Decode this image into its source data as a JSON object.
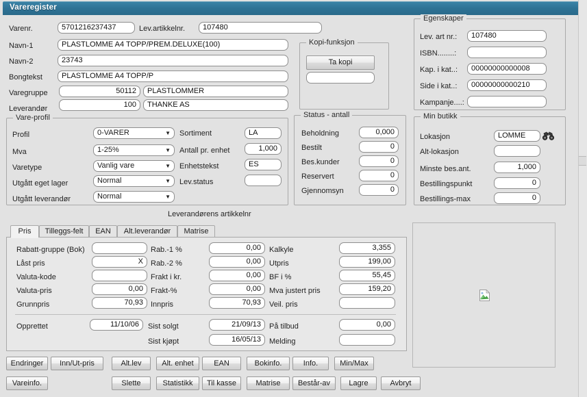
{
  "window": {
    "title": "Vareregister"
  },
  "top_fields": {
    "varenr_label": "Varenr.",
    "varenr_value": "5701216237437",
    "lev_artikkelnr_label": "Lev.artikkelnr.",
    "lev_artikkelnr_value": "107480",
    "navn1_label": "Navn-1",
    "navn1_value": "PLASTLOMME A4 TOPP/PREM.DELUXE(100)",
    "navn2_label": "Navn-2",
    "navn2_value": "23743",
    "bongtekst_label": "Bongtekst",
    "bongtekst_value": "PLASTLOMME A4 TOPP/P",
    "varegruppe_label": "Varegruppe",
    "varegruppe_code": "50112",
    "varegruppe_name": "PLASTLOMMER",
    "leverandor_label": "Leverandør",
    "leverandor_code": "100",
    "leverandor_name": "THANKE AS"
  },
  "vare_profil": {
    "caption": "Vare-profil",
    "rows": [
      {
        "label": "Profil",
        "value": "0-VARER"
      },
      {
        "label": "Mva",
        "value": "1-25%"
      },
      {
        "label": "Varetype",
        "value": "Vanlig vare"
      },
      {
        "label": "Utgått eget lager",
        "value": "Normal"
      },
      {
        "label": "Utgått leverandør",
        "value": "Normal"
      }
    ],
    "right_rows": [
      {
        "label": "Sortiment",
        "value": "LA",
        "align": "left"
      },
      {
        "label": "Antall pr. enhet",
        "value": "1,000",
        "align": "right"
      },
      {
        "label": "Enhetstekst",
        "value": "ES",
        "align": "left"
      },
      {
        "label": "Lev.status",
        "value": "",
        "align": "left"
      }
    ],
    "footer_note": "Leverandørens artikkelnr"
  },
  "kopi_funksjon": {
    "caption": "Kopi-funksjon",
    "button_label": "Ta kopi",
    "field_value": ""
  },
  "status_antall": {
    "caption": "Status - antall",
    "rows": [
      {
        "label": "Beholdning",
        "value": "0,000"
      },
      {
        "label": "Bestilt",
        "value": "0"
      },
      {
        "label": "Bes.kunder",
        "value": "0"
      },
      {
        "label": "Reservert",
        "value": "0"
      },
      {
        "label": "Gjennomsyn",
        "value": "0"
      }
    ]
  },
  "egenskaper": {
    "caption": "Egenskaper",
    "rows": [
      {
        "label": "Lev. art nr.:",
        "value": "107480"
      },
      {
        "label": "ISBN........:",
        "value": ""
      },
      {
        "label": "Kap. i kat..:",
        "value": "00000000000008"
      },
      {
        "label": "Side i kat..:",
        "value": "00000000000210"
      },
      {
        "label": "Kampanje....:",
        "value": ""
      }
    ]
  },
  "min_butikk": {
    "caption": "Min butikk",
    "rows": [
      {
        "label": "Lokasjon",
        "value": "LOMME",
        "align": "left"
      },
      {
        "label": "Alt-lokasjon",
        "value": "",
        "align": "left"
      },
      {
        "label": "Minste bes.ant.",
        "value": "1,000",
        "align": "right"
      },
      {
        "label": "Bestillingspunkt",
        "value": "0",
        "align": "right"
      },
      {
        "label": "Bestillings-max",
        "value": "0",
        "align": "right"
      }
    ],
    "lookup_icon": "binoculars-icon"
  },
  "tabs": [
    {
      "label": "Pris",
      "active": true
    },
    {
      "label": "Tilleggs-felt",
      "active": false
    },
    {
      "label": "EAN",
      "active": false
    },
    {
      "label": "Alt.leverandør",
      "active": false
    },
    {
      "label": "Matrise",
      "active": false
    }
  ],
  "pris_tab": {
    "col1": [
      {
        "label": "Rabatt-gruppe (Bok)",
        "value": "",
        "align": "left"
      },
      {
        "label": "Låst pris",
        "value": "X",
        "align": "right"
      },
      {
        "label": "Valuta-kode",
        "value": "",
        "align": "left"
      },
      {
        "label": "Valuta-pris",
        "value": "0,00",
        "align": "right"
      },
      {
        "label": "Grunnpris",
        "value": "70,93",
        "align": "right"
      }
    ],
    "col2": [
      {
        "label": "Rab.-1 %",
        "value": "0,00"
      },
      {
        "label": "Rab.-2 %",
        "value": "0,00"
      },
      {
        "label": "Frakt i kr.",
        "value": "0,00"
      },
      {
        "label": "Frakt-%",
        "value": "0,00"
      },
      {
        "label": "Innpris",
        "value": "70,93"
      }
    ],
    "col3": [
      {
        "label": "Kalkyle",
        "value": "3,355"
      },
      {
        "label": "Utpris",
        "value": "199,00"
      },
      {
        "label": "BF i %",
        "value": "55,45"
      },
      {
        "label": "Mva justert pris",
        "value": "159,20"
      },
      {
        "label": "Veil. pris",
        "value": ""
      }
    ],
    "dates": {
      "opprettet_label": "Opprettet",
      "opprettet_value": "11/10/06",
      "sist_solgt_label": "Sist solgt",
      "sist_solgt_value": "21/09/13",
      "sist_kjopt_label": "Sist kjøpt",
      "sist_kjopt_value": "16/05/13",
      "pa_tilbud_label": "På tilbud",
      "pa_tilbud_value": "0,00",
      "melding_label": "Melding",
      "melding_value": ""
    }
  },
  "buttons_row1": [
    {
      "label": "Endringer"
    },
    {
      "label": "Inn/Ut-pris"
    },
    {
      "label": "Alt.lev"
    },
    {
      "label": "Alt. enhet"
    },
    {
      "label": "EAN"
    },
    {
      "label": "Bokinfo."
    },
    {
      "label": "Info."
    },
    {
      "label": "Min/Max"
    }
  ],
  "buttons_row2": [
    {
      "label": "Vareinfo."
    },
    {
      "label": "Slette"
    },
    {
      "label": "Statistikk"
    },
    {
      "label": "Til kasse"
    },
    {
      "label": "Matrise"
    },
    {
      "label": "Består-av"
    },
    {
      "label": "Lagre"
    },
    {
      "label": "Avbryt"
    }
  ],
  "image_panel": {
    "placeholder_icon": "broken-image-icon"
  },
  "colors": {
    "titlebar": "#2e7295",
    "background": "#e2e2e2",
    "field_border": "#8e8e8e",
    "group_border": "#a9a9a9"
  }
}
